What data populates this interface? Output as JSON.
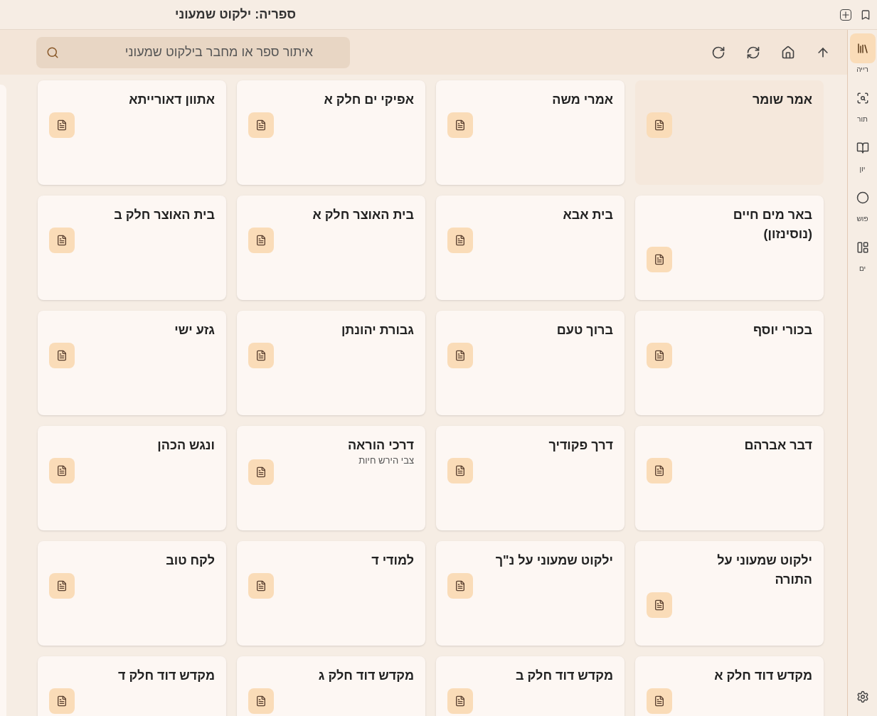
{
  "title_bar": {
    "title": "ספריה: ילקוט שמעוני"
  },
  "search": {
    "placeholder": "איתור ספר או מחבר בילקוט שמעוני"
  },
  "books": [
    {
      "title": "אמר שומר",
      "selected": true
    },
    {
      "title": "אמרי משה",
      "selected": false
    },
    {
      "title": "אפיקי ים חלק א",
      "selected": false
    },
    {
      "title": "אתוון דאורייתא",
      "selected": false
    },
    {
      "title": "באר מים חיים (נוסינזון)",
      "selected": false
    },
    {
      "title": "בית אבא",
      "selected": false
    },
    {
      "title": "בית האוצר חלק א",
      "selected": false
    },
    {
      "title": "בית האוצר חלק ב",
      "selected": false
    },
    {
      "title": "בכורי יוסף",
      "selected": false
    },
    {
      "title": "ברוך טעם",
      "selected": false
    },
    {
      "title": "גבורת יהונתן",
      "selected": false
    },
    {
      "title": "גזע ישי",
      "selected": false
    },
    {
      "title": "דבר אברהם",
      "selected": false
    },
    {
      "title": "דרך פקודיך",
      "selected": false
    },
    {
      "title": "דרכי הוראה",
      "author": "צבי הירש חיות",
      "selected": false
    },
    {
      "title": "ונגש הכהן",
      "selected": false
    },
    {
      "title": "ילקוט שמעוני על התורה",
      "selected": false
    },
    {
      "title": "ילקוט שמעוני על נ\"ך",
      "selected": false
    },
    {
      "title": "למודי ד",
      "selected": false
    },
    {
      "title": "לקח טוב",
      "selected": false
    },
    {
      "title": "מקדש דוד חלק א",
      "selected": false
    },
    {
      "title": "מקדש דוד חלק ב",
      "selected": false
    },
    {
      "title": "מקדש דוד חלק ג",
      "selected": false
    },
    {
      "title": "מקדש דוד חלק ד",
      "selected": false
    }
  ],
  "sidebar": {
    "items": [
      {
        "label": "רייה",
        "selected": true
      },
      {
        "label": "תור",
        "selected": false
      },
      {
        "label": "יון",
        "selected": false
      },
      {
        "label": "פוש",
        "selected": false
      },
      {
        "label": "ים",
        "selected": false
      }
    ]
  }
}
